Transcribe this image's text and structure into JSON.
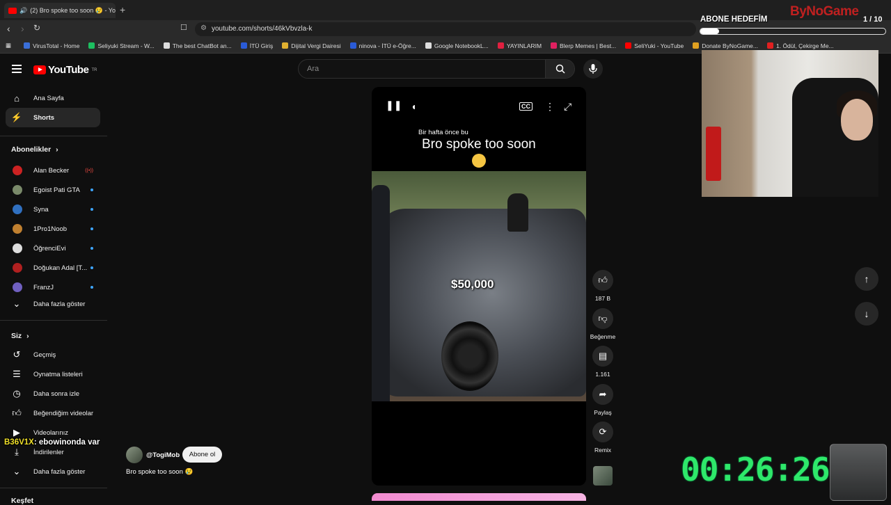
{
  "browser": {
    "tab_title": "(2) Bro spoke too soon 😢 - YouTube",
    "url": "youtube.com/shorts/46kVbvzla-k",
    "bookmarks": [
      {
        "label": "VirusTotal - Home",
        "color": "#3a6fd8"
      },
      {
        "label": "Seliyuki Stream - W...",
        "color": "#1dbf60"
      },
      {
        "label": "The best ChatBot an...",
        "color": "#dddddd"
      },
      {
        "label": "İTÜ Giriş",
        "color": "#2a5bd7"
      },
      {
        "label": "Dijital Vergi Dairesi",
        "color": "#e0b030"
      },
      {
        "label": "ninova - İTÜ e-Öğre...",
        "color": "#2a5bd7"
      },
      {
        "label": "Google NotebookL...",
        "color": "#dddddd"
      },
      {
        "label": "YAYINLARIM",
        "color": "#e02040"
      },
      {
        "label": "Blerp Memes | Best...",
        "color": "#e02060"
      },
      {
        "label": "SeliYuki - YouTube",
        "color": "#ff0000"
      },
      {
        "label": "Donate ByNoGame...",
        "color": "#e0a020"
      },
      {
        "label": "1. Ödül, Çekirge Me...",
        "color": "#e02020"
      }
    ]
  },
  "youtube": {
    "logo": "YouTube",
    "logo_sup": "TR",
    "search_placeholder": "Ara",
    "sidebar": {
      "main": [
        {
          "label": "Ana Sayfa",
          "icon": "home-icon"
        },
        {
          "label": "Shorts",
          "icon": "shorts-icon"
        }
      ],
      "subs_header": "Abonelikler",
      "subs": [
        {
          "label": "Alan Becker",
          "live": "red",
          "color": "#cc2222"
        },
        {
          "label": "Egoist Pati GTA",
          "live": "blue",
          "color": "#7a8a6a"
        },
        {
          "label": "Syna",
          "live": "blue",
          "color": "#3070c0"
        },
        {
          "label": "1Pro1Noob",
          "live": "blue",
          "color": "#c08030"
        },
        {
          "label": "ÖğrenciEvi",
          "live": "blue",
          "color": "#dddddd"
        },
        {
          "label": "Doğukan Adal [T...",
          "live": "blue",
          "color": "#b02020"
        },
        {
          "label": "FranzJ",
          "live": "blue",
          "color": "#7060c0"
        }
      ],
      "subs_more": "Daha fazla göster",
      "you_header": "Siz",
      "you": [
        {
          "label": "Geçmiş",
          "icon": "history-icon"
        },
        {
          "label": "Oynatma listeleri",
          "icon": "playlist-icon"
        },
        {
          "label": "Daha sonra izle",
          "icon": "clock-icon"
        },
        {
          "label": "Beğendiğim videolar",
          "icon": "thumbs-up-icon"
        },
        {
          "label": "Videolarınız",
          "icon": "video-icon"
        },
        {
          "label": "İndirilenler",
          "icon": "download-icon"
        }
      ],
      "you_more": "Daha fazla göster",
      "explore_header": "Keşfet"
    },
    "short": {
      "caption_small": "Bir hafta önce bu",
      "caption_big": "Bro spoke too soon",
      "price_overlay": "$50,000",
      "channel": "@TogiMob",
      "subscribe": "Abone ol",
      "title": "Bro spoke too soon 😢"
    },
    "actions": {
      "likes": "187 B",
      "dislike": "Beğenme",
      "comments": "1.161",
      "share": "Paylaş",
      "remix": "Remix"
    }
  },
  "overlay": {
    "goal_title": "ABONE HEDEFİM",
    "goal_count": "1 / 10",
    "goal_progress": 0.1,
    "brand": "ByNoGame",
    "chat_user": "B36V1X",
    "chat_message": ": ebowinonda var",
    "timer": "00:26:26"
  }
}
